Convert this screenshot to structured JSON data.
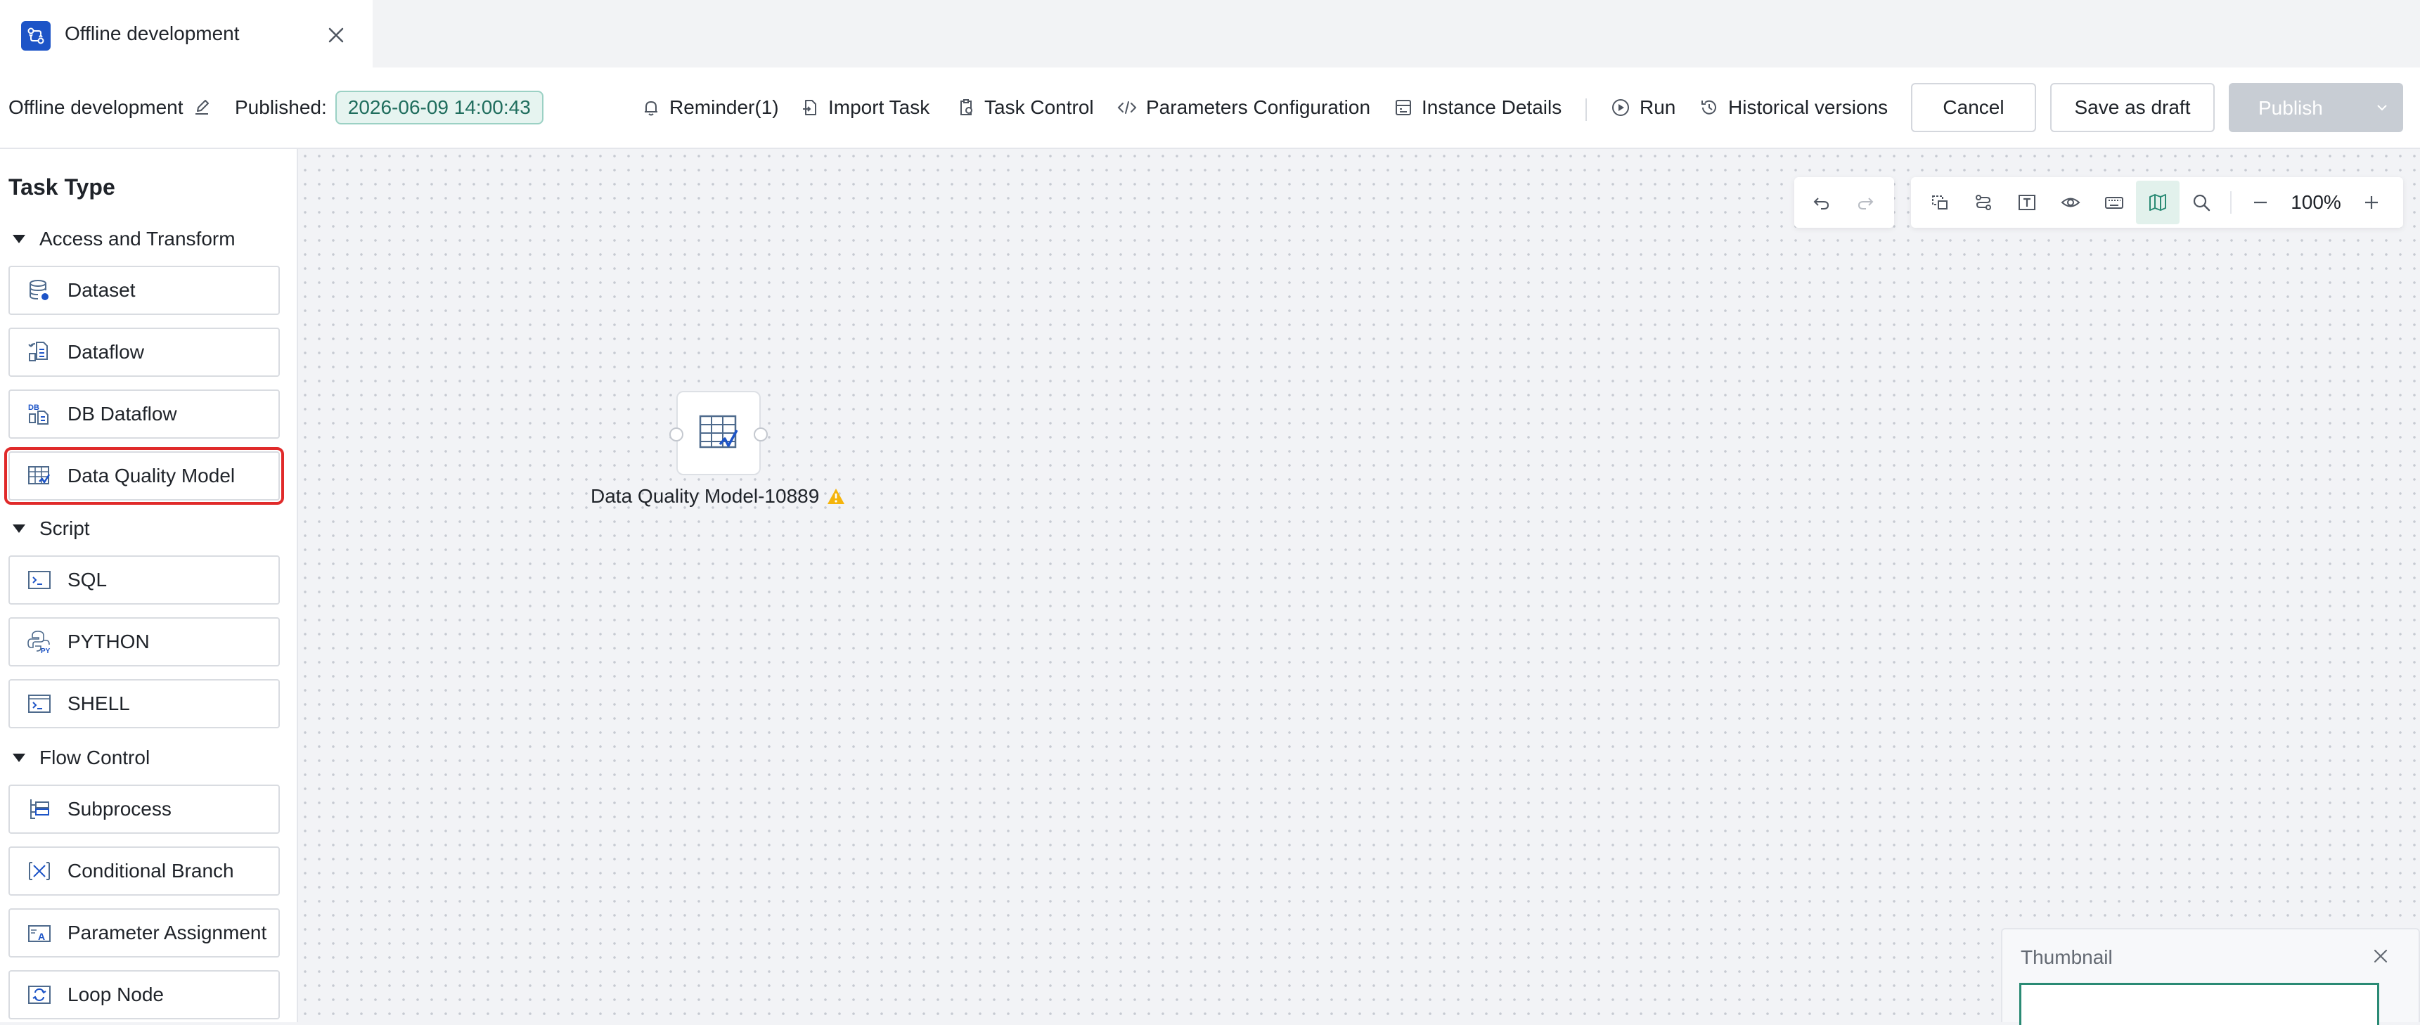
{
  "tab": {
    "title": "Offline development",
    "icon": "workflow-icon"
  },
  "header": {
    "name": "Offline development",
    "published_label": "Published:",
    "published_time": "2026-06-09 14:00:43",
    "actions": {
      "reminder": "Reminder(1)",
      "import_task": "Import Task",
      "task_control": "Task Control",
      "parameters": "Parameters Configuration",
      "instance_details": "Instance Details",
      "run": "Run",
      "history": "Historical versions"
    },
    "buttons": {
      "cancel": "Cancel",
      "save_draft": "Save as draft",
      "publish": "Publish"
    }
  },
  "sidebar": {
    "title": "Task Type",
    "groups": [
      {
        "label": "Access and Transform",
        "items": [
          {
            "label": "Dataset",
            "icon": "dataset-icon"
          },
          {
            "label": "Dataflow",
            "icon": "dataflow-icon"
          },
          {
            "label": "DB Dataflow",
            "icon": "db-dataflow-icon"
          },
          {
            "label": "Data Quality Model",
            "icon": "data-quality-icon"
          }
        ]
      },
      {
        "label": "Script",
        "items": [
          {
            "label": "SQL",
            "icon": "sql-icon"
          },
          {
            "label": "PYTHON",
            "icon": "python-icon"
          },
          {
            "label": "SHELL",
            "icon": "shell-icon"
          }
        ]
      },
      {
        "label": "Flow Control",
        "items": [
          {
            "label": "Subprocess",
            "icon": "subprocess-icon"
          },
          {
            "label": "Conditional Branch",
            "icon": "conditional-branch-icon"
          },
          {
            "label": "Parameter Assignment",
            "icon": "parameter-assignment-icon"
          },
          {
            "label": "Loop Node",
            "icon": "loop-node-icon"
          }
        ]
      }
    ],
    "selected": "Data Quality Model"
  },
  "canvas": {
    "zoom": "100%",
    "node": {
      "label": "Data Quality Model-10889",
      "status": "warning"
    },
    "thumbnail": {
      "title": "Thumbnail"
    }
  },
  "colors": {
    "accent": "#1d54c7",
    "selected_outline": "#e02a2a",
    "warning": "#f5b40b",
    "badge_bg": "#e6f4f0",
    "badge_text": "#1f6d5d"
  }
}
